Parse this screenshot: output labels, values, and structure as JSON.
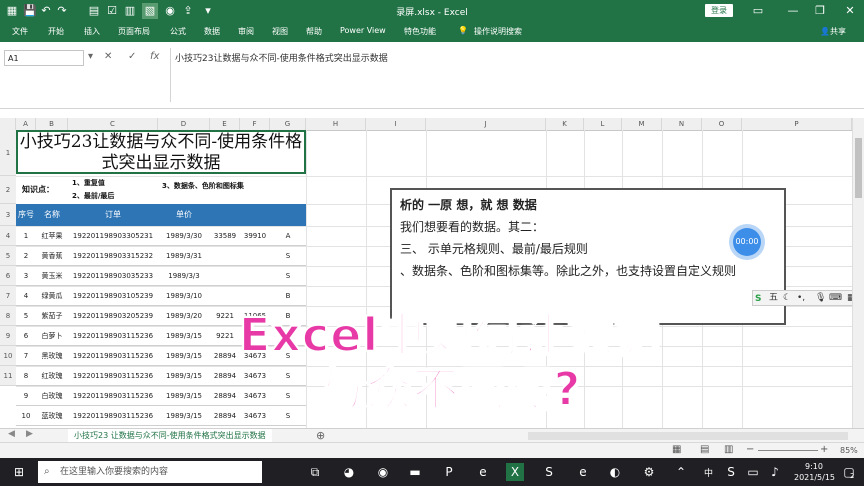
{
  "window": {
    "doc_title": "录屏.xlsx  -  Excel",
    "login_label": "登录",
    "share_label": "共享"
  },
  "ribbon": {
    "tabs": [
      "文件",
      "开始",
      "插入",
      "页面布局",
      "公式",
      "数据",
      "审阅",
      "视图",
      "帮助",
      "Power View",
      "特色功能",
      "操作说明搜索"
    ]
  },
  "formula_bar": {
    "name_box": "A1",
    "formula": "小技巧23让数据与众不同-使用条件格式突出显示数据"
  },
  "columns": [
    "A",
    "B",
    "C",
    "D",
    "E",
    "F",
    "G",
    "H",
    "I",
    "J",
    "K",
    "L",
    "M",
    "N",
    "O",
    "P"
  ],
  "rows": [
    "1",
    "2",
    "3",
    "4",
    "5",
    "6",
    "7",
    "8",
    "9",
    "10",
    "11"
  ],
  "sheet": {
    "title": "小技巧23让数据与众不同-使用条件格式突出显示数据",
    "knowledge_label": "知识点：",
    "knowledge_1": "1、重复值",
    "knowledge_2": "2、最前/最后",
    "knowledge_3": "3、数据条、色阶和图标集",
    "headers": [
      "序号",
      "名称",
      "订单",
      "单价",
      "",
      ""
    ],
    "table": [
      [
        "1",
        "红苹果",
        "192201198903305231",
        "1989/3/30",
        "33589",
        "39910",
        "A"
      ],
      [
        "2",
        "黄香蕉",
        "192201198903315232",
        "1989/3/31",
        "",
        "",
        "S"
      ],
      [
        "3",
        "黄玉米",
        "192201198903035233",
        "1989/3/3",
        "",
        "",
        "S"
      ],
      [
        "4",
        "绿黄瓜",
        "192201198903105239",
        "1989/3/10",
        "",
        "",
        "B"
      ],
      [
        "5",
        "紫茄子",
        "192201198903205239",
        "1989/3/20",
        "9221",
        "11065",
        "B"
      ],
      [
        "6",
        "白萝卜",
        "192201198903115236",
        "1989/3/15",
        "9221",
        "11065",
        "B"
      ],
      [
        "7",
        "黑玫瑰",
        "192201198903115236",
        "1989/3/15",
        "28894",
        "34673",
        "S"
      ],
      [
        "8",
        "红玫瑰",
        "192201198903115236",
        "1989/3/15",
        "28894",
        "34673",
        "S"
      ],
      [
        "9",
        "白玫瑰",
        "192201198903115236",
        "1989/3/15",
        "28894",
        "34673",
        "S"
      ],
      [
        "10",
        "蓝玫瑰",
        "192201198903115236",
        "1989/3/15",
        "28894",
        "34673",
        "S"
      ]
    ]
  },
  "note": {
    "line1": "析的     一原  想，就     想  数据",
    "line2": "        我们想要看的数据。其二：",
    "line3": "三、              示单元格规则、最前/最后规则",
    "line4": "、数据条、色阶和图标集等。除此之外，也支持设置自定义规则"
  },
  "timer": "00:00",
  "ime": "五",
  "overlay": {
    "line1": "Excel中如何让数据",
    "line2": "与众不同呢?"
  },
  "sheet_tab": "小技巧23 让数据与众不同-使用条件格式突出显示数据",
  "status": {
    "zoom": "85%"
  },
  "taskbar": {
    "search_placeholder": "在这里输入你要搜索的内容",
    "ime": "中",
    "time": "9:10",
    "date": "2021/5/15",
    "notification_count": "2"
  }
}
